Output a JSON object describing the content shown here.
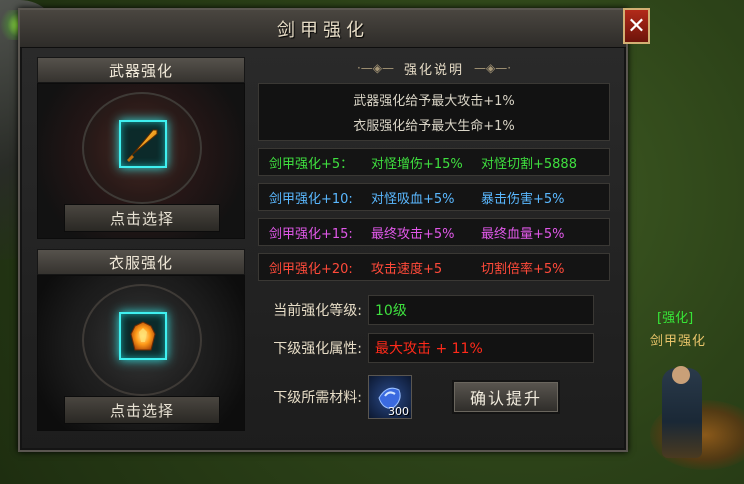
{
  "window": {
    "title": "剑甲强化",
    "close_label": "✕"
  },
  "weapon_panel": {
    "header": "武器强化",
    "select_label": "点击选择",
    "icon": "golden-sword-icon"
  },
  "armor_panel": {
    "header": "衣服强化",
    "select_label": "点击选择",
    "icon": "flame-armor-icon"
  },
  "description": {
    "header": "强化说明",
    "lines": [
      "武器强化给予最大攻击+1%",
      "衣服强化给予最大生命+1%"
    ]
  },
  "bonus_tiers": [
    {
      "level": "剑甲强化+5：",
      "bonus_a": "对怪增伤+15%",
      "bonus_b": "对怪切割+5888",
      "color": "#3fe03f"
    },
    {
      "level": "剑甲强化+10:",
      "bonus_a": "对怪吸血+5%",
      "bonus_b": "暴击伤害+5%",
      "color": "#5ab8ff"
    },
    {
      "level": "剑甲强化+15:",
      "bonus_a": "最终攻击+5%",
      "bonus_b": "最终血量+5%",
      "color": "#e058e8"
    },
    {
      "level": "剑甲强化+20:",
      "bonus_a": "攻击速度+5",
      "bonus_b": "切割倍率+5%",
      "color": "#ff4a3a"
    }
  ],
  "current_level": {
    "label": "当前强化等级:",
    "value": "10级"
  },
  "next_attribute": {
    "label": "下级强化属性:",
    "value": "最大攻击 + 11%"
  },
  "materials": {
    "label": "下级所需材料:",
    "count": "300",
    "icon": "blue-gem-icon"
  },
  "confirm_label": "确认提升",
  "npc": {
    "tag": "[强化]",
    "name": "剑甲强化"
  }
}
